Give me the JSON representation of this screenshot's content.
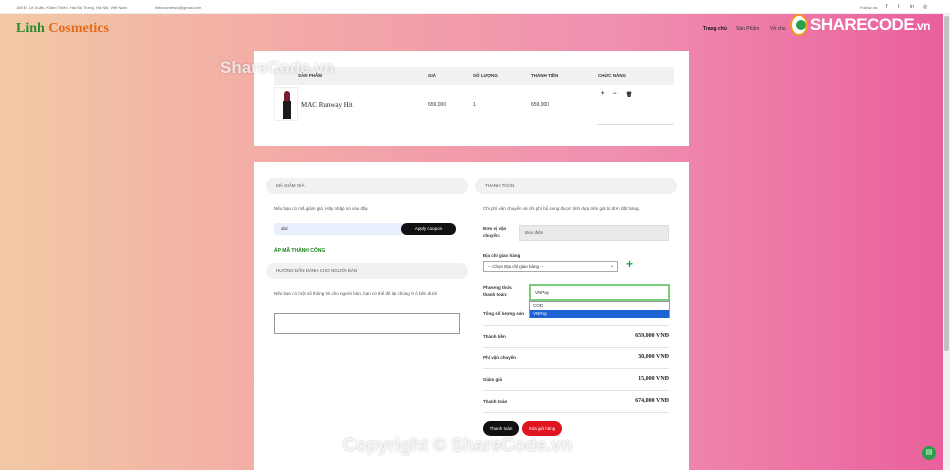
{
  "topbar": {
    "address": "158 Đ. Lê Duẩn, Khâm Thiên, Hai Bà Trưng, Hà Nội, Việt Nam",
    "email": "linhcosmetics@gmail.com",
    "follow": "Follow us:",
    "social_icons": [
      "facebook-icon",
      "twitter-icon",
      "linkedin-icon",
      "instagram-icon"
    ]
  },
  "nav": {
    "brand_part1": "Linh",
    "brand_part2": "Cosmetics",
    "items": [
      "Trang chủ",
      "Sản Phẩm",
      "Về chú"
    ]
  },
  "watermark": {
    "logo_text": "SHARECODE",
    "logo_suffix": ".vn",
    "text1": "ShareCode.vn",
    "text2": "Copyright © ShareCode.vn"
  },
  "cart": {
    "headers": [
      "Sản phẩm",
      "Giá",
      "Số lượng",
      "Thành tiền",
      "Chức năng"
    ],
    "rows": [
      {
        "name": "MAC Runway Hit",
        "price": "659,000",
        "qty": "1",
        "total": "659,000"
      }
    ],
    "actions": [
      "+",
      "−",
      "🗑"
    ]
  },
  "coupon": {
    "title": "Mã giảm giá",
    "hint": "Nếu bạn có mã giảm giá ,Hãy nhập nó vào đây",
    "value": "abc",
    "button": "Apply coupon",
    "success": "Áp mã thành công"
  },
  "seller_note": {
    "title": "Hướng dẫn dành cho người bán",
    "hint": "Nếu bạn có một số thông tin cho người bán, bạn có thể để lại chúng ở ô bên dưới"
  },
  "checkout": {
    "title": "Thanh toán",
    "note": "Chi phí vận chuyển và chi phí bổ sung được tính dựa trên giá trị đơn đặt hàng.",
    "shipper_label": "Đơn vị vận chuyển:",
    "shipper_value": "Bưu điện",
    "address_label": "Địa chỉ giao hàng",
    "address_placeholder": "-- Chọn Địa chỉ giao hàng --",
    "payment_label": "Phương thức thanh toán:",
    "payment_value": "VNPay",
    "payment_options": [
      "COD",
      "VNPay"
    ],
    "qty_label": "Tổng số lượng sản",
    "summary": [
      {
        "label": "Thành tiền",
        "value": "659,000 VNĐ"
      },
      {
        "label": "Phí vận chuyển",
        "value": "30,000 VNĐ"
      },
      {
        "label": "Giảm giá",
        "value": "15,000 VNĐ"
      },
      {
        "label": "Thanh toán",
        "value": "674,000 VNĐ"
      }
    ],
    "pay_button": "Thanh toán",
    "clear_button": "Xóa giỏ hàng"
  }
}
